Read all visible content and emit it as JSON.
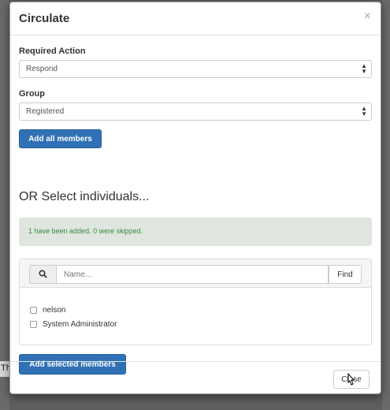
{
  "background": {
    "fragment_text": "Th"
  },
  "modal": {
    "title": "Circulate",
    "close_glyph": "×",
    "required_action": {
      "label": "Required Action",
      "value": "Respond"
    },
    "group": {
      "label": "Group",
      "value": "Registered"
    },
    "add_all_label": "Add all members",
    "or_heading": "OR Select individuals...",
    "alert_text": "1 have been added. 0 were skipped.",
    "search": {
      "placeholder": "Name...",
      "find_label": "Find"
    },
    "members": [
      "nelson",
      "System Administrator"
    ],
    "add_selected_label": "Add selected members",
    "footer_close_label": "Close"
  },
  "colors": {
    "primary": "#3071b5",
    "success_text": "#3a8a3a",
    "alert_bg": "#dfe5df"
  }
}
